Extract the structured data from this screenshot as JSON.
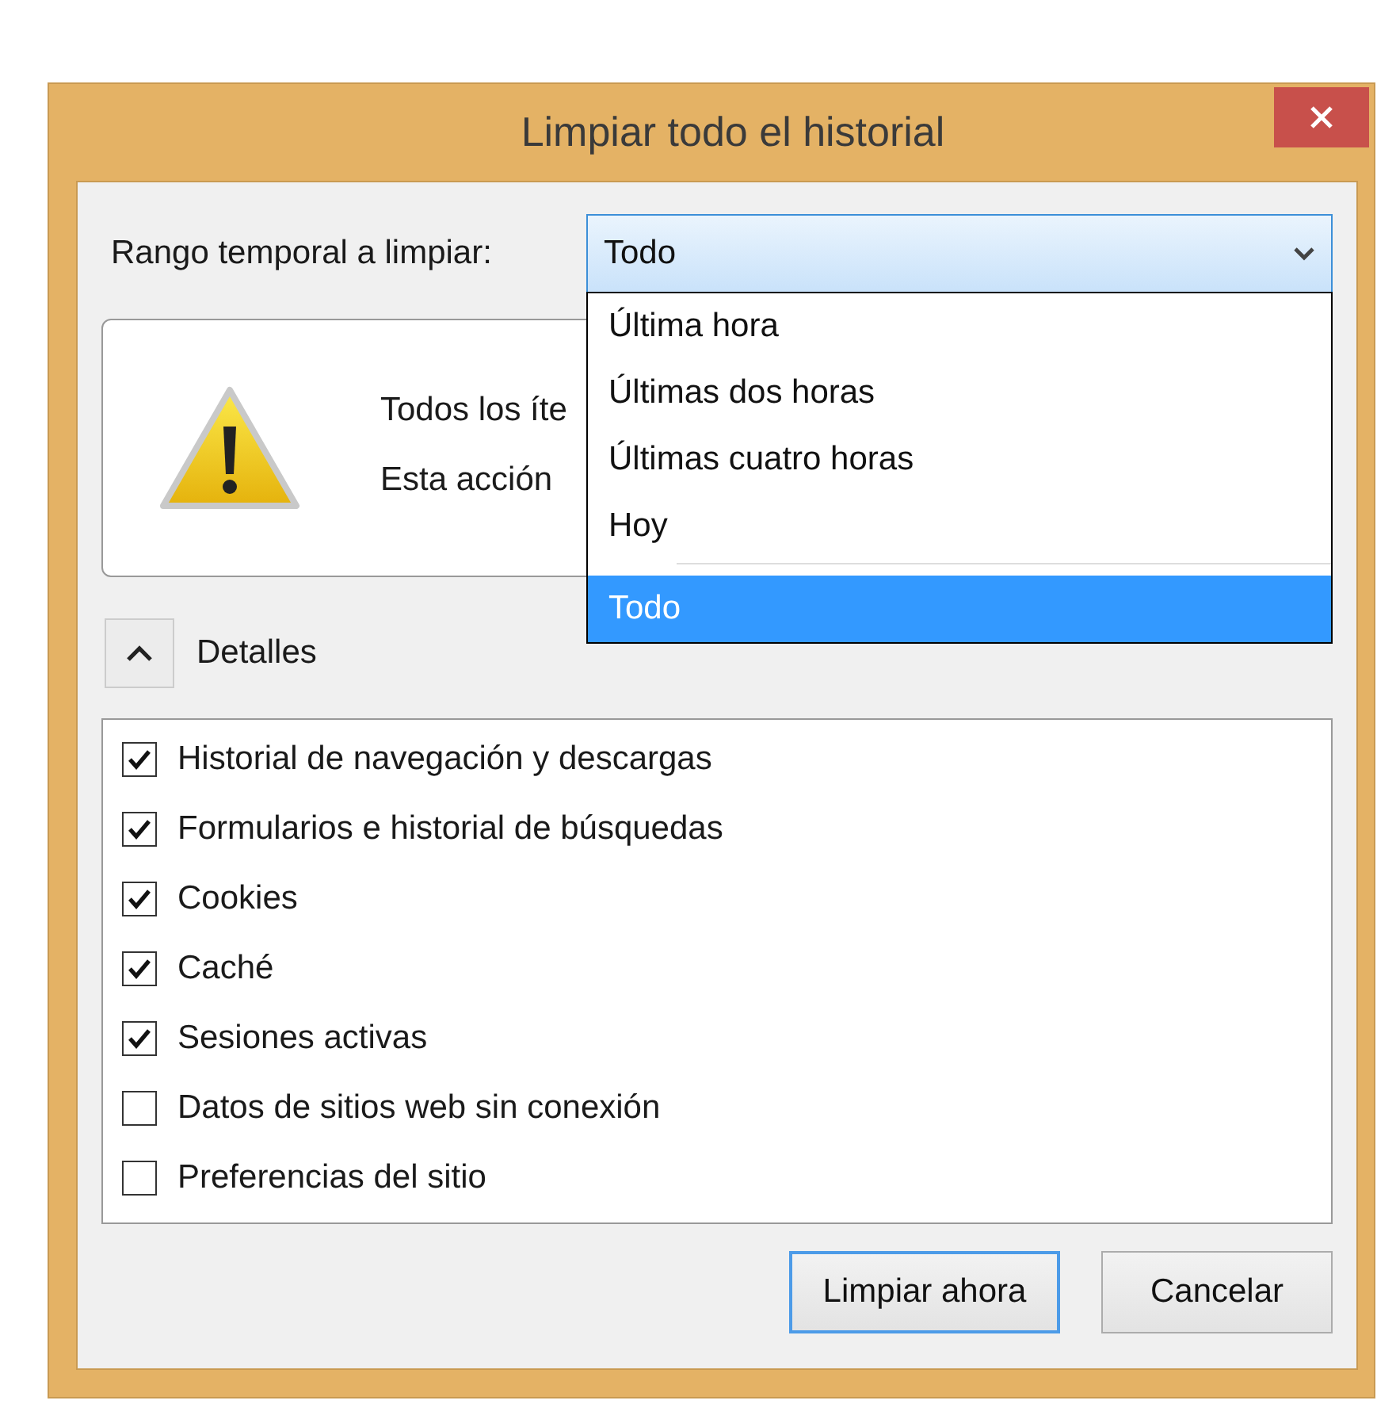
{
  "window": {
    "title": "Limpiar todo el historial"
  },
  "time_range": {
    "label": "Rango temporal a limpiar:",
    "value": "Todo",
    "open": true,
    "options": [
      {
        "kind": "option",
        "label": "Última hora",
        "selected": false
      },
      {
        "kind": "option",
        "label": "Últimas dos horas",
        "selected": false
      },
      {
        "kind": "option",
        "label": "Últimas cuatro horas",
        "selected": false
      },
      {
        "kind": "option",
        "label": "Hoy",
        "selected": false
      },
      {
        "kind": "separator"
      },
      {
        "kind": "option",
        "label": "Todo",
        "selected": true
      }
    ]
  },
  "warning": {
    "lines": [
      "Todos los íte",
      "Esta acción"
    ]
  },
  "details": {
    "label": "Detalles",
    "expanded": true
  },
  "items": [
    {
      "label": "Historial de navegación y descargas",
      "checked": true
    },
    {
      "label": "Formularios e historial de búsquedas",
      "checked": true
    },
    {
      "label": "Cookies",
      "checked": true
    },
    {
      "label": "Caché",
      "checked": true
    },
    {
      "label": "Sesiones activas",
      "checked": true
    },
    {
      "label": "Datos de sitios web sin conexión",
      "checked": false
    },
    {
      "label": "Preferencias del sitio",
      "checked": false
    }
  ],
  "buttons": [
    {
      "label": "Limpiar ahora",
      "default": true
    },
    {
      "label": "Cancelar",
      "default": false
    }
  ]
}
